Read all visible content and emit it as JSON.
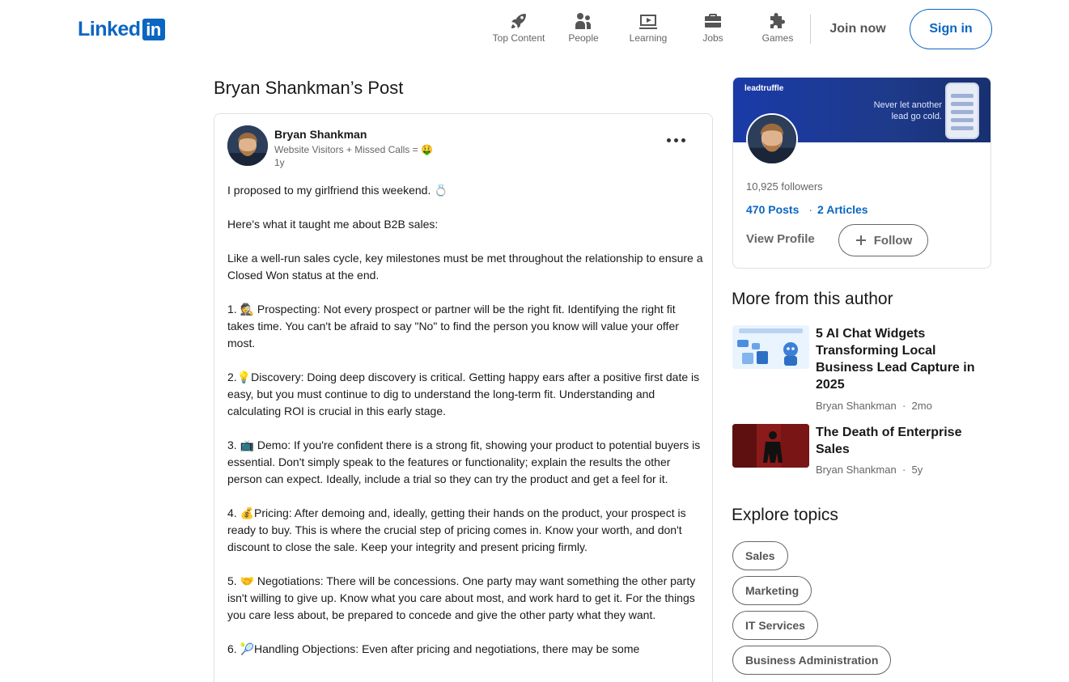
{
  "header": {
    "logo_text": "Linked",
    "logo_box": "in",
    "nav": [
      {
        "label": "Top Content",
        "icon": "rocket-icon"
      },
      {
        "label": "People",
        "icon": "people-icon"
      },
      {
        "label": "Learning",
        "icon": "learning-icon"
      },
      {
        "label": "Jobs",
        "icon": "briefcase-icon"
      },
      {
        "label": "Games",
        "icon": "puzzle-icon"
      }
    ],
    "join_label": "Join now",
    "signin_label": "Sign in"
  },
  "page_title": "Bryan Shankman’s Post",
  "post": {
    "author": "Bryan Shankman",
    "headline": "Website Visitors + Missed Calls = 🤑",
    "time": "1y",
    "paragraphs": [
      "I proposed to my girlfriend this weekend. 💍",
      "Here's what it taught me about B2B sales:",
      "Like a well-run sales cycle, key milestones must be met throughout the relationship to ensure a Closed Won status at the end.",
      "1. 🕵 Prospecting: Not every prospect or partner will be the right fit. Identifying the right fit takes time. You can't be afraid to say \"No\" to find the person you know will value your offer most.",
      "2.💡Discovery: Doing deep discovery is critical. Getting happy ears after a positive first date is easy, but you must continue to dig to understand the long-term fit. Understanding and calculating ROI is crucial in this early stage.",
      "3. 📺 Demo: If you're confident there is a strong fit, showing your product to potential buyers is essential. Don't simply speak to the features or functionality; explain the results the other person can expect. Ideally, include a trial so they can try the product and get a feel for it.",
      "4. 💰Pricing: After demoing and, ideally, getting their hands on the product, your prospect is ready to buy. This is where the crucial step of pricing comes in. Know your worth, and don't discount to close the sale. Keep your integrity and present pricing firmly.",
      "5. 🤝 Negotiations: There will be concessions. One party may want something the other party isn't willing to give up. Know what you care about most, and work hard to get it. For the things you care less about, be prepared to concede and give the other party what they want.",
      "6. 🎾Handling Objections: Even after pricing and negotiations, there may be some"
    ]
  },
  "profile_card": {
    "banner_brand": "leadtruffle",
    "banner_tagline": "Never let another lead go cold.",
    "followers": "10,925 followers",
    "posts": "470 Posts",
    "articles": "2 Articles",
    "view_profile": "View Profile",
    "follow": "Follow"
  },
  "more_from_author": {
    "title": "More from this author",
    "articles": [
      {
        "title": "5 AI Chat Widgets Transforming Local Business Lead Capture in 2025",
        "author": "Bryan Shankman",
        "age": "2mo"
      },
      {
        "title": "The Death of Enterprise Sales",
        "author": "Bryan Shankman",
        "age": "5y"
      }
    ]
  },
  "explore_topics": {
    "title": "Explore topics",
    "topics": [
      "Sales",
      "Marketing",
      "IT Services",
      "Business Administration"
    ]
  },
  "colors": {
    "brand": "#0a66c2",
    "text": "#191919",
    "muted": "#666666"
  }
}
